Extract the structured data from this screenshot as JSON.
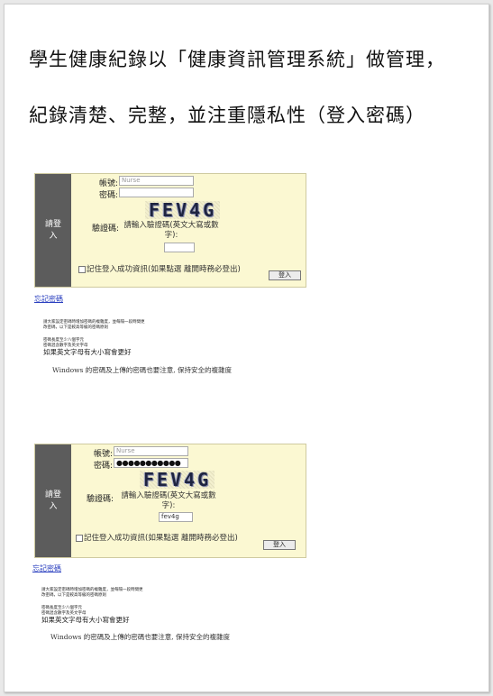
{
  "heading": {
    "line1": "學生健康紀錄以「健康資訊管理系統」做管理，",
    "line2": "紀錄清楚、完整，並注重隱私性（登入密碼）"
  },
  "captures": [
    {
      "side_label": "請登入",
      "account_label": "帳號:",
      "account_placeholder": "Nurse",
      "password_label": "密碼:",
      "password_value": "",
      "captcha_text": "FEV4G",
      "verify_label": "驗證碼:",
      "verify_hint": "請輸入驗證碼(英文大寫或數字):",
      "verify_value": "",
      "remember_text": "記住登入成功資訊(如果點選 離開時務必登出)",
      "login_button": "登入",
      "forgot_link": "忘記密碼",
      "tips": {
        "line1": "請大家設定密碼時增加密碼的複雜度，並每隔一段時間更",
        "line2": "改密碼，以下是較高等級的密碼原則",
        "line3": "密碼長度至少八個字元",
        "line4": "密碼混含數字及英文字母",
        "line5": "如果英文字母有大小寫會更好",
        "line6": "Windows 的密碼及上傳的密碼也要注意, 保持安全的複雜度"
      }
    },
    {
      "side_label": "請登入",
      "account_label": "帳號:",
      "account_placeholder": "Nurse",
      "password_label": "密碼:",
      "password_value": "●●●●●●●●●●●",
      "captcha_text": "FEV4G",
      "verify_label": "驗證碼:",
      "verify_hint": "請輸入驗證碼(英文大寫或數字):",
      "verify_value": "fev4g",
      "remember_text": "記住登入成功資訊(如果點選 離開時務必登出)",
      "login_button": "登入",
      "forgot_link": "忘記密碼",
      "tips": {
        "line1": "請大家設定密碼時增加密碼的複雜度，並每隔一段時間更",
        "line2": "改密碼，以下是較高等級的密碼原則",
        "line3": "密碼長度至少八個字元",
        "line4": "密碼混含數字及英文字母",
        "line5": "如果英文字母有大小寫會更好",
        "line6": "Windows 的密碼及上傳的密碼也要注意, 保持安全的複雜度"
      }
    }
  ]
}
